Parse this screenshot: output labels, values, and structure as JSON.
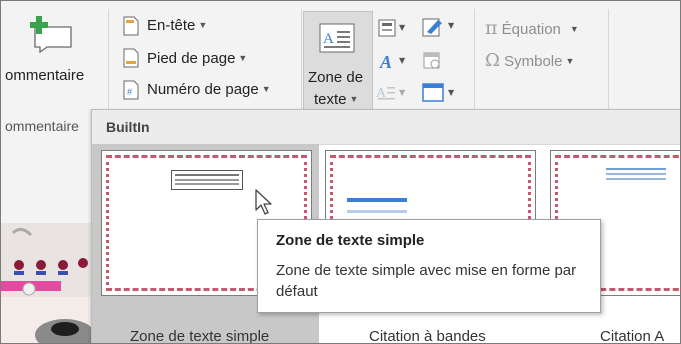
{
  "ribbon": {
    "comment_button": "ommentaire",
    "comment_group": "ommentaire",
    "header_button": "En-tête",
    "footer_button": "Pied de page",
    "page_number_button": "Numéro de page",
    "textbox_button_line1": "Zone de",
    "textbox_button_line2": "texte",
    "equation_button": "Équation",
    "symbol_button": "Symbole"
  },
  "gallery": {
    "section_title": "BuiltIn",
    "items": [
      {
        "caption": "Zone de texte simple"
      },
      {
        "caption": "Citation à bandes"
      },
      {
        "caption": "Citation A"
      }
    ]
  },
  "tooltip": {
    "title": "Zone de texte simple",
    "description": "Zone de texte simple avec mise en forme par défaut"
  },
  "colors": {
    "accent_green": "#3aa24a",
    "border_pink": "#c45b6d",
    "accent_blue": "#3b7fd4",
    "selected_bg": "#c8c8c8"
  }
}
